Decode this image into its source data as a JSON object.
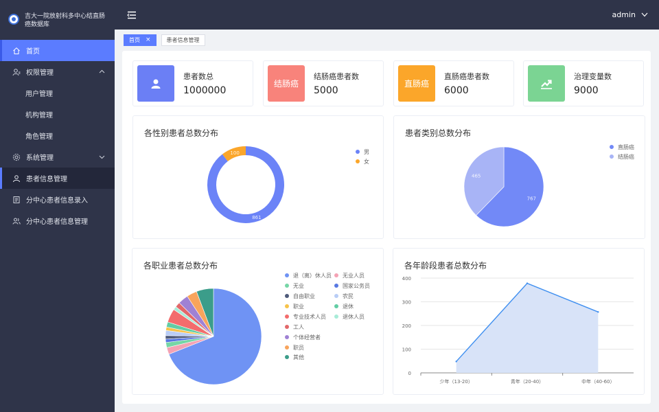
{
  "app": {
    "title": "吉大一院放射科多中心结直肠癌数据库"
  },
  "sidebar": {
    "items": [
      {
        "label": "首页",
        "icon": "home-icon"
      },
      {
        "label": "权限管理",
        "icon": "user-settings-icon"
      },
      {
        "label": "用户管理"
      },
      {
        "label": "机构管理"
      },
      {
        "label": "角色管理"
      },
      {
        "label": "系统管理",
        "icon": "gear-icon"
      },
      {
        "label": "患者信息管理",
        "icon": "user-icon"
      },
      {
        "label": "分中心患者信息录入",
        "icon": "document-icon"
      },
      {
        "label": "分中心患者信息管理",
        "icon": "users-icon"
      }
    ]
  },
  "header": {
    "user": "admin"
  },
  "tabs": [
    {
      "label": "首页"
    },
    {
      "label": "患者信息管理"
    }
  ],
  "stats": [
    {
      "label": "患者数总",
      "value": "1000000",
      "icon": "user-icon",
      "color": "#6b7ff5"
    },
    {
      "label": "结肠癌患者数",
      "value": "5000",
      "badge_text": "结肠癌",
      "color": "#f8837b"
    },
    {
      "label": "直肠癌患者数",
      "value": "6000",
      "badge_text": "直肠癌",
      "color": "#fba62a"
    },
    {
      "label": "治理变量数",
      "value": "9000",
      "icon": "trend-up-icon",
      "color": "#7bd493"
    }
  ],
  "chart_data": [
    {
      "type": "pie",
      "variant": "donut",
      "title": "各性别患者总数分布",
      "categories": [
        "男",
        "女"
      ],
      "values": [
        861,
        100
      ],
      "data_labels": [
        "861",
        "100"
      ],
      "colors": [
        "#6b83f7",
        "#fba62a"
      ],
      "legend": "top-right"
    },
    {
      "type": "pie",
      "title": "患者类别总数分布",
      "categories": [
        "直肠癌",
        "结肠癌"
      ],
      "values": [
        767,
        465
      ],
      "data_labels": [
        "767",
        "465"
      ],
      "colors": [
        "#7289f7",
        "#a8b4f6"
      ],
      "legend": "top-right"
    },
    {
      "type": "pie",
      "title": "各职业患者总数分布",
      "categories": [
        "退（离）休人员",
        "无业人员",
        "无业",
        "国家公务员",
        "自由职业",
        "农民",
        "职业",
        "退休",
        "专业技术人员",
        "退休人员",
        "工人",
        "个体经营者",
        "职员",
        "其他"
      ],
      "values": [
        120,
        4,
        3,
        2,
        2,
        3,
        2,
        3,
        8,
        2,
        3,
        6,
        6,
        10
      ],
      "colors": [
        "#6f93f4",
        "#f4a2b4",
        "#76d6a6",
        "#5878e2",
        "#4e5a7a",
        "#b9cdf6",
        "#f7c34a",
        "#62cda4",
        "#f36c6c",
        "#a8ecd8",
        "#e2686a",
        "#9f81d4",
        "#f8a45c",
        "#3b9d8a"
      ],
      "legend": "right"
    },
    {
      "type": "area",
      "title": "各年龄段患者总数分布",
      "categories": [
        "少年（13-20）",
        "青年（20-40）",
        "中年（40-60）"
      ],
      "values": [
        48,
        378,
        257
      ],
      "ylim": [
        0,
        400
      ],
      "yticks": [
        "0",
        "100",
        "200",
        "300",
        "400"
      ],
      "grid": true,
      "line_color": "#3f8ff0",
      "fill_color": "#d8e3f8"
    }
  ]
}
